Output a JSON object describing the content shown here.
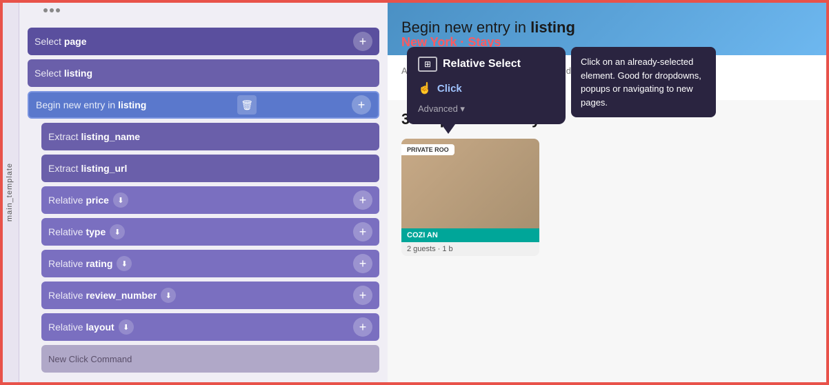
{
  "sidebar": {
    "label": "main_template"
  },
  "dots": [
    "•",
    "•",
    "•"
  ],
  "commands": {
    "select_page": {
      "prefix": "Select",
      "name": "page",
      "has_plus": true
    },
    "select_listing": {
      "prefix": "Select",
      "name": "listing",
      "has_plus": false
    },
    "begin_entry": {
      "prefix": "Begin new entry in",
      "name": "listing",
      "has_trash": true,
      "has_plus": true
    },
    "extract_listing_name": {
      "prefix": "Extract",
      "name": "listing_name"
    },
    "extract_listing_url": {
      "prefix": "Extract",
      "name": "listing_url"
    },
    "relative_price": {
      "prefix": "Relative",
      "name": "price",
      "has_download": true,
      "has_plus": true
    },
    "relative_type": {
      "prefix": "Relative",
      "name": "type",
      "has_download": true,
      "has_plus": true
    },
    "relative_rating": {
      "prefix": "Relative",
      "name": "rating",
      "has_download": true,
      "has_plus": true
    },
    "relative_review_number": {
      "prefix": "Relative",
      "name": "review_number",
      "has_download": true,
      "has_plus": true
    },
    "relative_layout": {
      "prefix": "Relative",
      "name": "layout",
      "has_download": true,
      "has_plus": true
    },
    "new_click": {
      "label": "New Click Command"
    }
  },
  "tooltip": {
    "title": "Relative Select",
    "icon_label": "⊞",
    "options": [
      {
        "icon": "☝",
        "label": "Click"
      }
    ],
    "advanced_label": "Advanced ▾",
    "description": "Click on an already-selected element. Good for dropdowns, popups or navigating to new pages."
  },
  "webpage": {
    "header_title": "Begin new entry in ",
    "header_title_bold": "listing",
    "header_subtitle": "New York · Stays",
    "fees_text": "Additional fees apply. Taxes may be added.",
    "places_title": "300+ places to stay",
    "listing_card": {
      "badge": "PRIVATE ROO",
      "name": "COZI AN",
      "detail": "2 guests · 1 b"
    }
  }
}
